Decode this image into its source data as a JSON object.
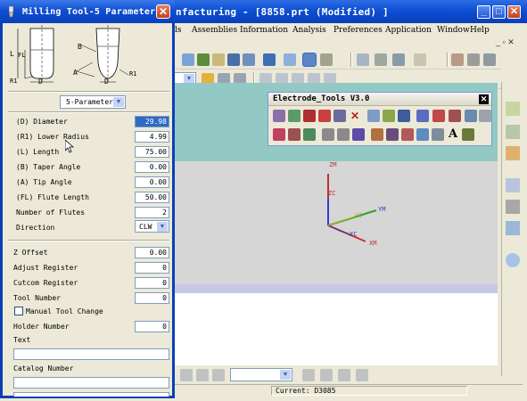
{
  "main_window": {
    "title": "nfacturing - [8858.prt (Modified) ]",
    "controls": {
      "minimize": "_",
      "maximize": "□",
      "close": "✕"
    },
    "mdi_controls": "_ ▫ ✕",
    "menu": [
      "ls",
      "Assemblies",
      "Information",
      "Analysis",
      "Preferences",
      "Application",
      "Window",
      "Help"
    ]
  },
  "electrode_toolbar": {
    "title": "Electrode_Tools V3.0",
    "close": "✕",
    "letter_icon": "A"
  },
  "viewport": {
    "axes": {
      "zm": "ZM",
      "zc": "ZC",
      "ym": "YM",
      "yc": "YC",
      "xc": "XC",
      "xm": "XM"
    }
  },
  "status": {
    "current": "Current: D3085"
  },
  "dialog": {
    "title": "Milling Tool-5 Parameters",
    "close": "✕",
    "diagram": {
      "l": "L",
      "fl": "FL",
      "d": "D",
      "r1": "R1",
      "b": "B",
      "a": "A",
      "r1_right": "R1",
      "d_right": "D"
    },
    "type_select": "5-Parameter",
    "params": [
      {
        "label": "(D) Diameter",
        "value": "29.98"
      },
      {
        "label": "(R1) Lower Radius",
        "value": "4.99"
      },
      {
        "label": "(L) Length",
        "value": "75.00"
      },
      {
        "label": "(B) Taper Angle",
        "value": "0.00"
      },
      {
        "label": "(A) Tip Angle",
        "value": "0.00"
      },
      {
        "label": "(FL) Flute Length",
        "value": "50.00"
      },
      {
        "label": "Number of Flutes",
        "value": "2"
      }
    ],
    "direction": {
      "label": "Direction",
      "value": "CLW"
    },
    "z_offset": {
      "label": "Z Offset",
      "value": "0.00"
    },
    "adjust_register": {
      "label": "Adjust Register",
      "value": "0"
    },
    "cutcom_register": {
      "label": "Cutcom Register",
      "value": "0"
    },
    "tool_number": {
      "label": "Tool Number",
      "value": "0"
    },
    "manual_tool_change": {
      "label": "Manual Tool Change"
    },
    "holder_number": {
      "label": "Holder Number",
      "value": "0"
    },
    "text": {
      "label": "Text",
      "value": ""
    },
    "catalog_number": {
      "label": "Catalog Number",
      "value": ""
    }
  }
}
